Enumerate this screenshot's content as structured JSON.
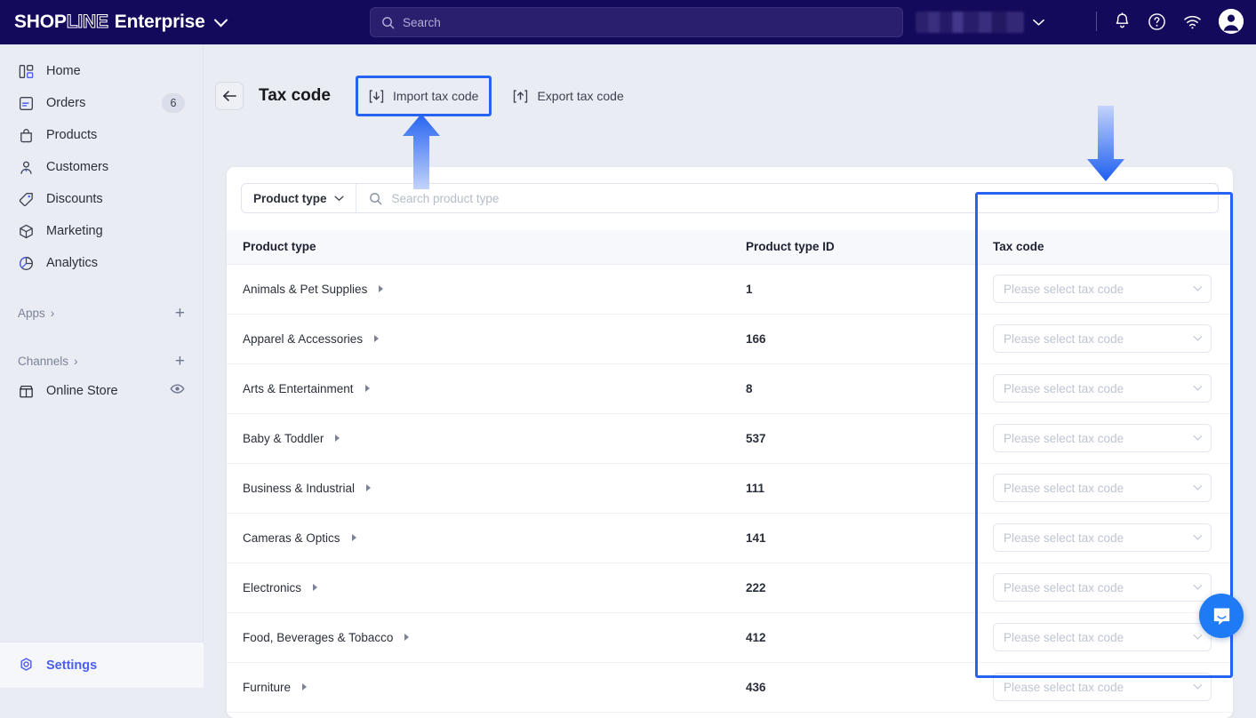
{
  "topbar": {
    "logo": {
      "shop": "SHOP",
      "line": "LINE",
      "suffix": "Enterprise"
    },
    "logo_chevron_icon": "chevron-down-icon",
    "search": {
      "placeholder": "Search",
      "icon": "search-icon"
    },
    "store_chevron_icon": "chevron-down-icon",
    "icons": {
      "notifications": "bell-icon",
      "help": "question-circle-icon",
      "wifi": "wifi-icon",
      "account": "avatar-icon"
    }
  },
  "sidebar": {
    "items": [
      {
        "label": "Home",
        "icon": "home-icon",
        "badge": ""
      },
      {
        "label": "Orders",
        "icon": "orders-icon",
        "badge": "6"
      },
      {
        "label": "Products",
        "icon": "products-bag-icon",
        "badge": ""
      },
      {
        "label": "Customers",
        "icon": "customers-person-icon",
        "badge": ""
      },
      {
        "label": "Discounts",
        "icon": "discounts-tag-icon",
        "badge": ""
      },
      {
        "label": "Marketing",
        "icon": "marketing-cube-icon",
        "badge": ""
      },
      {
        "label": "Analytics",
        "icon": "analytics-pie-icon",
        "badge": ""
      }
    ],
    "sections": [
      {
        "label": "Apps",
        "chevron": "›",
        "add": "+"
      },
      {
        "label": "Channels",
        "chevron": "›",
        "add": "+"
      }
    ],
    "channels": [
      {
        "label": "Online Store",
        "icon": "store-icon",
        "action_icon": "eye-icon"
      }
    ],
    "settings": {
      "label": "Settings",
      "icon": "settings-gear-icon"
    }
  },
  "page": {
    "back_icon": "arrow-left-icon",
    "title": "Tax code",
    "import_button": {
      "label": "Import tax code",
      "icon": "import-download-icon"
    },
    "export_button": {
      "label": "Export tax code",
      "icon": "export-upload-icon"
    }
  },
  "filter": {
    "product_type_label": "Product type",
    "product_type_chevron": "chevron-down-icon",
    "search_icon": "search-icon",
    "search_placeholder": "Search product type",
    "search_value": ""
  },
  "table": {
    "columns": [
      "Product type",
      "Product type ID",
      "Tax code"
    ],
    "select_placeholder": "Please select tax code",
    "rows": [
      {
        "product_type": "Animals & Pet Supplies",
        "id": "1",
        "tax_code": ""
      },
      {
        "product_type": "Apparel & Accessories",
        "id": "166",
        "tax_code": ""
      },
      {
        "product_type": "Arts & Entertainment",
        "id": "8",
        "tax_code": ""
      },
      {
        "product_type": "Baby & Toddler",
        "id": "537",
        "tax_code": ""
      },
      {
        "product_type": "Business & Industrial",
        "id": "111",
        "tax_code": ""
      },
      {
        "product_type": "Cameras & Optics",
        "id": "141",
        "tax_code": ""
      },
      {
        "product_type": "Electronics",
        "id": "222",
        "tax_code": ""
      },
      {
        "product_type": "Food, Beverages & Tobacco",
        "id": "412",
        "tax_code": ""
      },
      {
        "product_type": "Furniture",
        "id": "436",
        "tax_code": ""
      }
    ]
  },
  "annotations": {
    "highlight_color": "#2563f0",
    "arrow_up_target": "import-tax-code-button",
    "arrow_down_target": "tax-code-column"
  },
  "chat": {
    "icon": "chat-bubble-icon"
  },
  "colors": {
    "topbar_bg": "#140a5c",
    "sidebar_bg": "#e9ecf2",
    "accent": "#4a5ef0",
    "highlight": "#2563f0",
    "chat_fab": "#1e7af5"
  }
}
